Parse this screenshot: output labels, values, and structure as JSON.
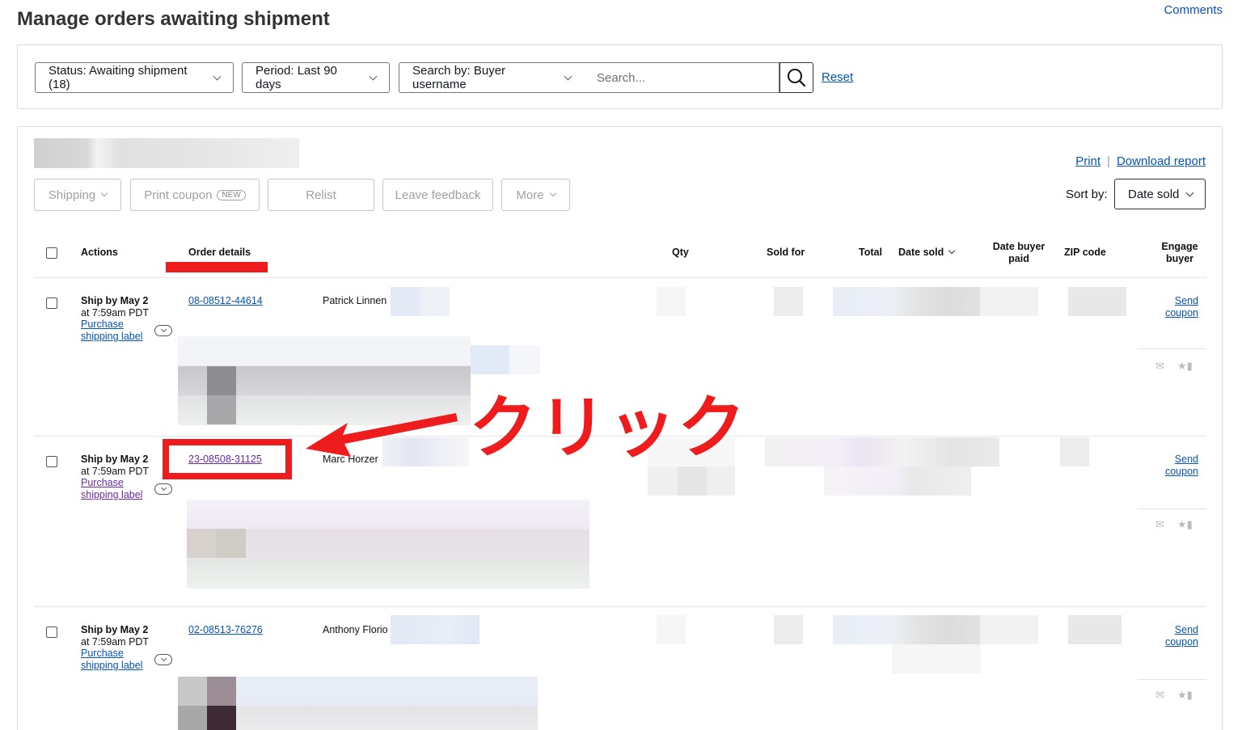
{
  "page": {
    "title": "Manage orders awaiting shipment",
    "comments_link": "Comments"
  },
  "filters": {
    "status": "Status: Awaiting shipment (18)",
    "period": "Period: Last 90 days",
    "search_by": "Search by: Buyer username",
    "search_placeholder": "Search...",
    "reset": "Reset"
  },
  "toolbar": {
    "print": "Print",
    "separator": "|",
    "download_report": "Download report",
    "shipping": "Shipping",
    "print_coupon": "Print coupon",
    "new_badge": "NEW",
    "relist": "Relist",
    "leave_feedback": "Leave feedback",
    "more": "More",
    "sort_by_label": "Sort by:",
    "sort_by_value": "Date sold"
  },
  "table": {
    "headers": {
      "actions": "Actions",
      "order_details": "Order details",
      "qty": "Qty",
      "sold_for": "Sold for",
      "total": "Total",
      "date_sold": "Date sold",
      "date_buyer_paid_1": "Date buyer",
      "date_buyer_paid_2": "paid",
      "zip_code": "ZIP code",
      "engage_buyer_1": "Engage",
      "engage_buyer_2": "buyer"
    },
    "rows": [
      {
        "ship_by": "Ship by May 2",
        "ship_time": "at 7:59am PDT",
        "label_line1": "Purchase",
        "label_line2": "shipping label",
        "order_number": "08-08512-44614",
        "buyer": "Patrick Linnen",
        "send_line1": "Send",
        "send_line2": "coupon"
      },
      {
        "ship_by": "Ship by May 2",
        "ship_time": "at 7:59am PDT",
        "label_line1": "Purchase",
        "label_line2": "shipping label",
        "order_number": "23-08508-31125",
        "buyer": "Marc Horzer",
        "send_line1": "Send",
        "send_line2": "coupon"
      },
      {
        "ship_by": "Ship by May 2",
        "ship_time": "at 7:59am PDT",
        "label_line1": "Purchase",
        "label_line2": "shipping label",
        "order_number": "02-08513-76276",
        "buyer": "Anthony Florio",
        "send_line1": "Send",
        "send_line2": "coupon"
      }
    ]
  },
  "annotation": {
    "click_text": "クリック",
    "color": "#ee1c1c"
  },
  "colors": {
    "link": "#0654ba",
    "visited_link": "#6b2aa8"
  }
}
